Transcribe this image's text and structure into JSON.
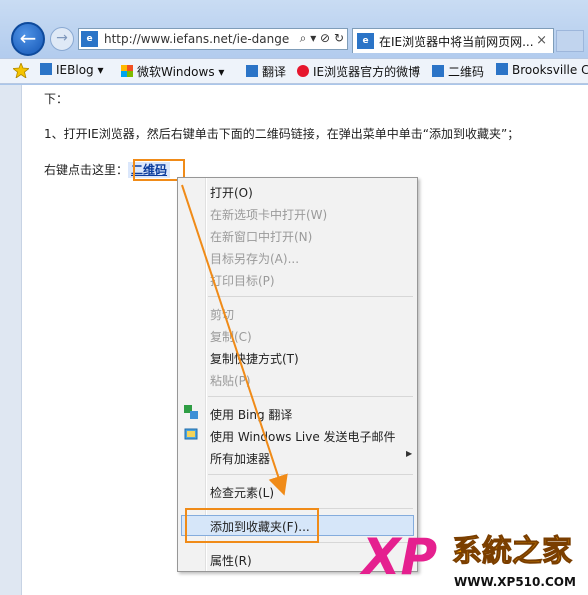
{
  "browser": {
    "address": "http://www.iefans.net/ie-dange",
    "tab_title": "在IE浏览器中将当前网页网...",
    "tab_close": "×",
    "favicon_label": "e"
  },
  "favbar": {
    "items": [
      "IEBlog ▾",
      "微软Windows ▾",
      "翻译",
      "IE浏览器官方的微博",
      "二维码",
      "Brooksville C"
    ]
  },
  "page": {
    "line1": "下：",
    "line2": "1、打开IE浏览器，然后右键单击下面的二维码链接，在弹出菜单中单击“添加到收藏夹”；",
    "line3_prefix": "右键点击这里：",
    "qr_link": "二维码"
  },
  "context_menu": {
    "open": "打开(O)",
    "open_new_tab": "在新选项卡中打开(W)",
    "open_new_window": "在新窗口中打开(N)",
    "save_target": "目标另存为(A)...",
    "print_target": "打印目标(P)",
    "cut": "剪切",
    "copy": "复制(C)",
    "copy_shortcut": "复制快捷方式(T)",
    "paste": "粘贴(P)",
    "bing_translate": "使用 Bing 翻译",
    "live_mail": "使用 Windows Live 发送电子邮件",
    "all_accelerators": "所有加速器",
    "inspect": "检查元素(L)",
    "add_favorites": "添加到收藏夹(F)...",
    "properties": "属性(R)"
  },
  "watermark": {
    "xp": "XP",
    "brand": "系統之家",
    "url": "WWW.XP510.COM"
  },
  "colors": {
    "highlight_orange": "#f08b18",
    "link_blue": "#0b3c9d",
    "menu_hover": "#d6e6f9"
  }
}
